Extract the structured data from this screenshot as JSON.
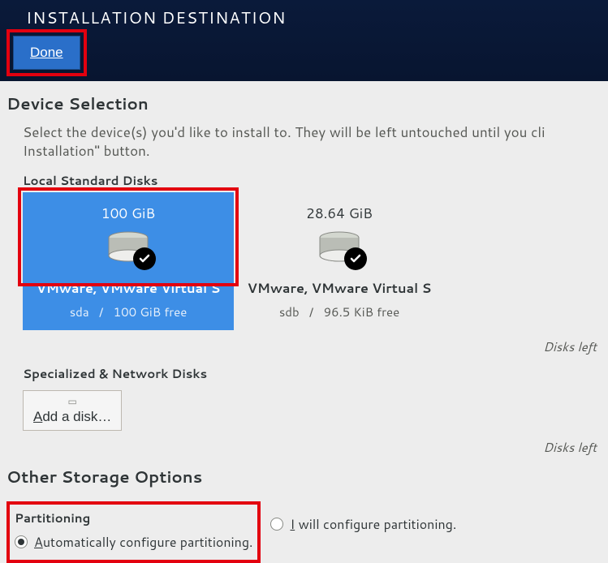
{
  "header": {
    "title": "INSTALLATION DESTINATION",
    "done_label": "Done"
  },
  "device_selection": {
    "heading": "Device Selection",
    "instructions": "Select the device(s) you'd like to install to.  They will be left untouched until you cli Installation\" button.",
    "local_disks_label": "Local Standard Disks",
    "disks_left_label": "Disks left",
    "disks": [
      {
        "size": "100 GiB",
        "name": "VMware, VMware Virtual S",
        "dev": "sda",
        "free": "100 GiB free",
        "selected": true
      },
      {
        "size": "28.64 GiB",
        "name": "VMware, VMware Virtual S",
        "dev": "sdb",
        "free": "96.5 KiB free",
        "selected": false
      }
    ]
  },
  "specialized": {
    "heading": "Specialized & Network Disks",
    "add_disk_label": "Add a disk…",
    "disks_left_label": "Disks left"
  },
  "other_storage": {
    "heading": "Other Storage Options",
    "partitioning_label": "Partitioning",
    "auto_label": "Automatically configure partitioning.",
    "manual_label": "I will configure partitioning.",
    "selected": "auto"
  }
}
